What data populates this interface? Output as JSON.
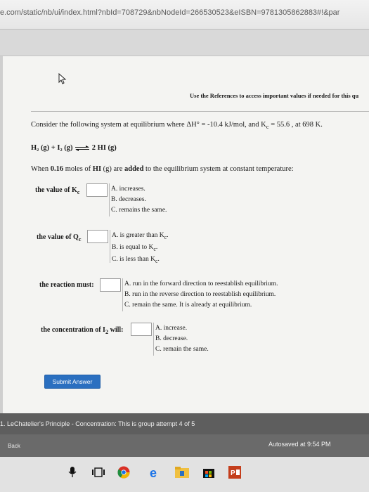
{
  "browser": {
    "url": "e.com/static/nb/ui/index.html?nbId=708729&nbNodeId=266530523&eISBN=9781305862883#!&par"
  },
  "header": {
    "references": "Use the References to access important values if needed for this qu"
  },
  "problem": {
    "consider": "Consider the following system at equilibrium where ΔH° = -10.4 kJ/mol, and K",
    "consider_sub": "c",
    "consider_tail": " = 55.6 , at 698 K.",
    "reaction_left": "H₂ (g) + I₂ (g)",
    "reaction_right": "2 HI (g)",
    "when_pre": "When ",
    "when_bold1": "0.16",
    "when_mid": " moles of ",
    "when_bold2": "HI",
    "when_mid2": " (g) are ",
    "when_bold3": "added",
    "when_end": " to the equilibrium system at constant temperature:"
  },
  "questions": [
    {
      "label": "the value of K",
      "label_sub": "c",
      "options": [
        "A. increases.",
        "B. decreases.",
        "C. remains the same."
      ]
    },
    {
      "label": "the value of Q",
      "label_sub": "c",
      "options": [
        "A. is greater than K",
        "B. is equal to K",
        "C. is less than K"
      ],
      "option_sub": "c"
    },
    {
      "label": "the reaction must:",
      "options": [
        "A. run in the forward direction to reestablish equilibrium.",
        "B. run in the reverse direction to reestablish equilibrium.",
        "C. remain the same. It is already at equilibrium."
      ]
    },
    {
      "label": "the concentration of I",
      "label_sub": "2",
      "label_tail": " will:",
      "options": [
        "A. increase.",
        "B. decrease.",
        "C. remain the same."
      ]
    }
  ],
  "submit_label": "Submit Answer",
  "status": {
    "text": "1. LeChatelier's Principle - Concentration: This is group attempt 4 of 5"
  },
  "footer": {
    "back_label": "Back",
    "autosaved": "Autosaved at 9:54 PM"
  },
  "colors": {
    "submit": "#2a6fc0",
    "statusbar": "#5e5e5e",
    "panel": "#f4f4f2"
  }
}
